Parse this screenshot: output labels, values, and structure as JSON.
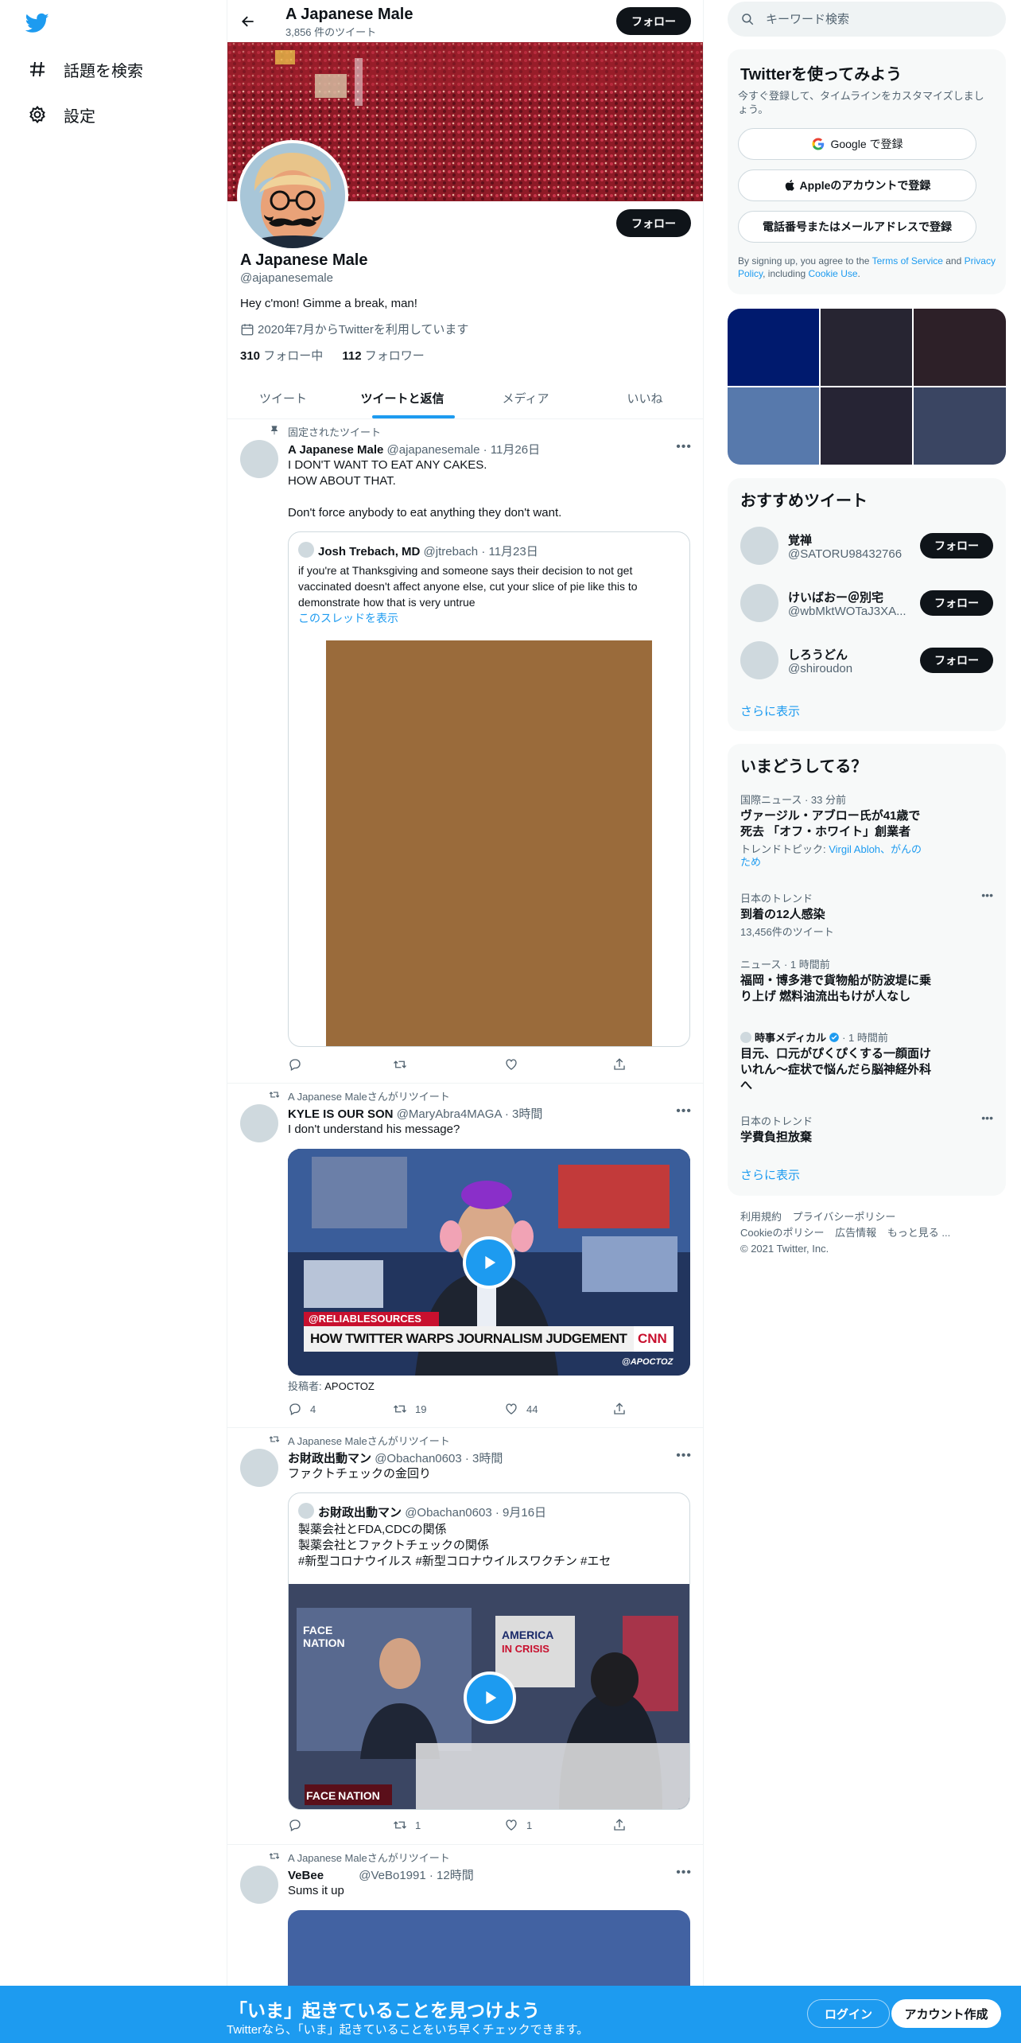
{
  "nav": {
    "explore_label": "話題を検索",
    "settings_label": "設定"
  },
  "profile": {
    "name": "A Japanese Male",
    "tweet_count": "3,856 件のツイート",
    "follow_label": "フォロー",
    "handle": "@ajapanesemale",
    "bio": "Hey c'mon! Gimme a break, man!",
    "joined": "2020年7月からTwitterを利用しています",
    "following_count": "310",
    "following_label": " フォロー中",
    "followers_count": "112",
    "followers_label": " フォロワー"
  },
  "tabs": [
    "ツイート",
    "ツイートと返信",
    "メディア",
    "いいね"
  ],
  "tweets": [
    {
      "context": "固定されたツイート",
      "name": "A Japanese Male",
      "handle": "@ajapanesemale",
      "time": "· 11月26日",
      "lines": [
        "I DON'T WANT TO EAT ANY CAKES.",
        "HOW ABOUT THAT.",
        "",
        "Don't force anybody to eat anything they don't want."
      ],
      "quote": {
        "name": "Josh Trebach, MD",
        "handle": "@jtrebach",
        "time": "· 11月23日",
        "text": "if you're at Thanksgiving and someone says their decision to not get vaccinated doesn't affect anyone else, cut your slice of pie like this to demonstrate how that is very untrue",
        "thread_link": "このスレッドを表示"
      },
      "counts": {
        "reply": "",
        "retweet": "",
        "like": ""
      }
    },
    {
      "context": "A Japanese Maleさんがリツイート",
      "name": "KYLE IS OUR SON",
      "handle": "@MaryAbra4MAGA",
      "time": "· 3時間",
      "text": "I don't understand his message?",
      "video_caption_1": "@RELIABLESOURCES",
      "video_caption_2": "HOW TWITTER WARPS JOURNALISM JUDGEMENT",
      "video_logo": "CNN",
      "video_watermark": "@APOCTOZ",
      "poster_label": "投稿者: ",
      "poster_name": "APOCTOZ",
      "counts": {
        "reply": "4",
        "retweet": "19",
        "like": "44"
      }
    },
    {
      "context": "A Japanese Maleさんがリツイート",
      "name": "お財政出動マン",
      "handle": "@Obachan0603",
      "time": "· 3時間",
      "text": "ファクトチェックの金回り",
      "quote": {
        "name": "お財政出動マン",
        "handle": "@Obachan0603",
        "time": "· 9月16日",
        "lines": [
          "製薬会社とFDA,CDCの関係",
          "製薬会社とファクトチェックの関係",
          "#新型コロナウイルス #新型コロナウイルスワクチン #エセ"
        ]
      },
      "video_label_1": "FACE NATION",
      "video_label_2": "FACE NATION",
      "video_label_3": "AMERICA",
      "video_label_4": "IN CRISIS",
      "counts": {
        "reply": "",
        "retweet": "1",
        "like": "1"
      }
    },
    {
      "context": "A Japanese Maleさんがリツイート",
      "name": "VeBee",
      "handle": "@VeBo1991",
      "time": "· 12時間",
      "text": "Sums it up"
    }
  ],
  "search": {
    "placeholder": "キーワード検索"
  },
  "signup_box": {
    "title": "Twitterを使ってみよう",
    "subtitle": "今すぐ登録して、タイムラインをカスタマイズしましょう。",
    "google": "Google で登録",
    "apple": "Appleのアカウントで登録",
    "phone": "電話番号またはメールアドレスで登録",
    "terms_prefix": "By signing up, you agree to the ",
    "terms": "Terms of Service",
    "and": " and ",
    "privacy": "Privacy Policy",
    "including": ", including ",
    "cookie": "Cookie Use",
    "period": "."
  },
  "recommend": {
    "title": "おすすめツイート",
    "follow_label": "フォロー",
    "users": [
      {
        "name": "覚禅",
        "handle": "@SATORU98432766"
      },
      {
        "name": "けいばおー＠別宅",
        "handle": "@wbMktWOTaJ3XA..."
      },
      {
        "name": "しろうどん",
        "handle": "@shiroudon"
      }
    ],
    "more": "さらに表示"
  },
  "trends": {
    "title": "いまどうしてる？",
    "items": [
      {
        "meta": "国際ニュース · 33 分前",
        "title": "ヴァージル・アブロー氏が41歳で死去 「オフ・ホワイト」創業者",
        "sub_prefix": "トレンドトピック: ",
        "sub_link": "Virgil Abloh、がんのため"
      },
      {
        "meta": "日本のトレンド",
        "title": "到着の12人感染",
        "sub": "13,456件のツイート"
      },
      {
        "meta": "ニュース · 1 時間前",
        "title": "福岡・博多港で貨物船が防波堤に乗り上げ 燃料油流出もけが人なし"
      },
      {
        "meta_name": "時事メディカル",
        "meta": "· 1 時間前",
        "title": "目元、口元がぴくぴくする一顔面けいれん～症状で悩んだら脳神経外科へ"
      },
      {
        "meta": "日本のトレンド",
        "title": "学費負担放棄"
      }
    ],
    "more": "さらに表示"
  },
  "footer": {
    "terms": "利用規約",
    "privacy": "プライバシーポリシー",
    "cookie": "Cookieのポリシー",
    "ads": "広告情報",
    "more": "もっと見る ...",
    "copyright": "© 2021 Twitter, Inc."
  },
  "bottom_bar": {
    "title": "「いま」起きていることを見つけよう",
    "subtitle": "Twitterなら、「いま」起きていることをいち早くチェックできます。",
    "login": "ログイン",
    "signup": "アカウント作成"
  },
  "colors": {
    "accent": "#1d9bf0",
    "text": "#0f1419",
    "secondary": "#536471"
  }
}
